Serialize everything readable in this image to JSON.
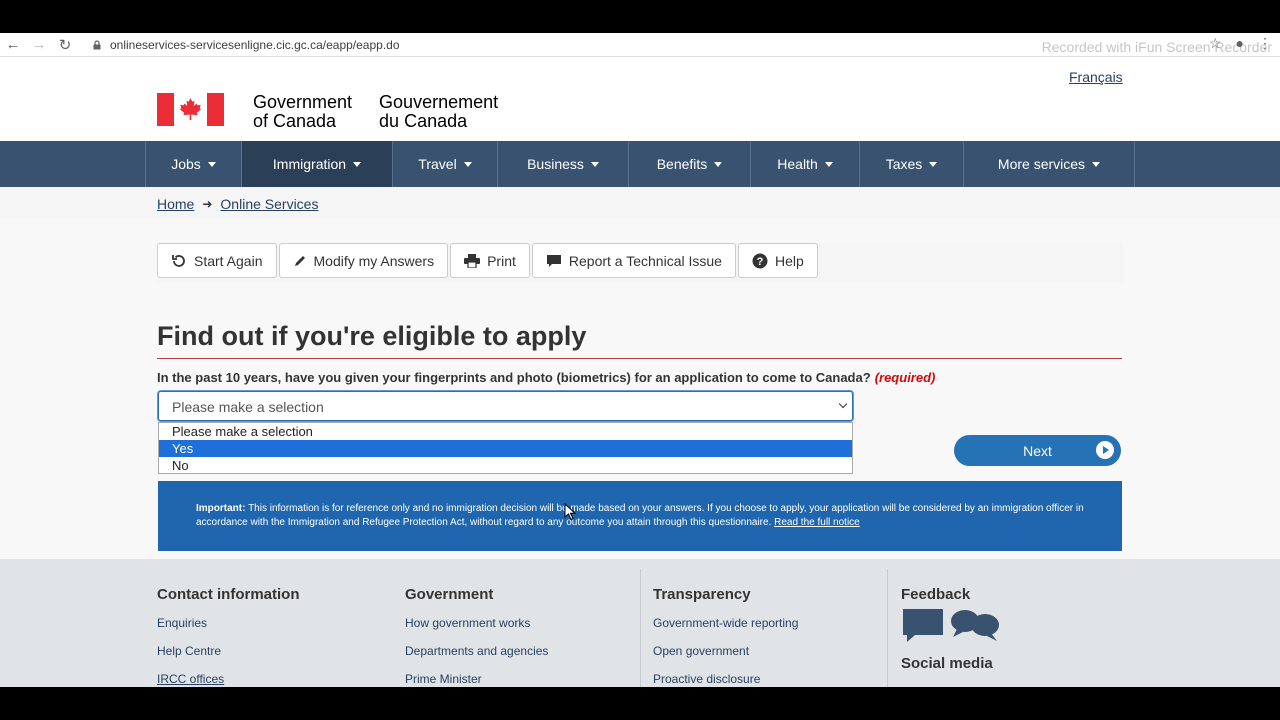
{
  "browser": {
    "url": "onlineservices-servicesenligne.cic.gc.ca/eapp/eapp.do",
    "watermark": "Recorded with iFun Screen Recorder"
  },
  "header": {
    "language_link": "Français",
    "gov_en_line1": "Government",
    "gov_en_line2": "of Canada",
    "gov_fr_line1": "Gouvernement",
    "gov_fr_line2": "du Canada"
  },
  "menu": {
    "items": [
      {
        "label": "Jobs"
      },
      {
        "label": "Immigration"
      },
      {
        "label": "Travel"
      },
      {
        "label": "Business"
      },
      {
        "label": "Benefits"
      },
      {
        "label": "Health"
      },
      {
        "label": "Taxes"
      },
      {
        "label": "More services"
      }
    ]
  },
  "breadcrumb": {
    "home": "Home",
    "current": "Online Services"
  },
  "toolbar": {
    "start_again": "Start Again",
    "modify": "Modify my Answers",
    "print": "Print",
    "report": "Report a Technical Issue",
    "help": "Help"
  },
  "main": {
    "title": "Find out if you're eligible to apply",
    "question": "In the past 10 years, have you given your fingerprints and photo (biometrics) for an application to come to Canada?",
    "required": "(required)",
    "select_value": "Please make a selection",
    "options": [
      "Please make a selection",
      "Yes",
      "No"
    ],
    "highlighted_option": "Yes",
    "next_label": "Next"
  },
  "notice": {
    "important_label": "Important:",
    "text": "This information is for reference only and no immigration decision will be made based on your answers. If you choose to apply, your application will be considered by an immigration officer in accordance with the Immigration and Refugee Protection Act, without regard to any outcome you attain through this questionnaire.",
    "link": "Read the full notice"
  },
  "footer": {
    "contact": {
      "title": "Contact information",
      "links": [
        "Enquiries",
        "Help Centre",
        "IRCC offices"
      ]
    },
    "government": {
      "title": "Government",
      "links": [
        "How government works",
        "Departments and agencies",
        "Prime Minister"
      ]
    },
    "transparency": {
      "title": "Transparency",
      "links": [
        "Government-wide reporting",
        "Open government",
        "Proactive disclosure"
      ]
    },
    "feedback": {
      "title": "Feedback",
      "social": "Social media"
    }
  },
  "colors": {
    "menu_bg": "#38526f",
    "menu_active": "#2b3f57",
    "primary_button": "#2572b4",
    "notice_bg": "#1f66ae",
    "flag_red": "#eb2d37",
    "required_red": "#d3080c"
  }
}
